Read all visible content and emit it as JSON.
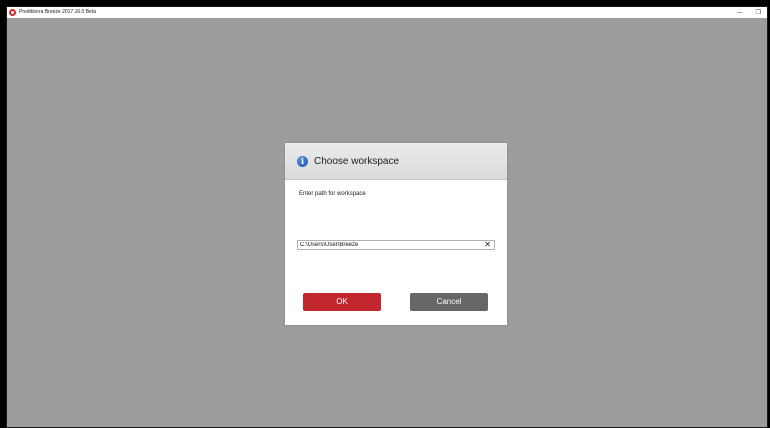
{
  "window": {
    "title": "Predikterra Breeze 2017.16.0 Beta",
    "minimize_glyph": "—",
    "maximize_glyph": "❐"
  },
  "dialog": {
    "title": "Choose workspace",
    "icon": "info-icon",
    "prompt": "Enter path for workspace",
    "path_value": "C:\\Users\\User\\Breeze",
    "clear_glyph": "✕",
    "ok_label": "OK",
    "cancel_label": "Cancel"
  },
  "colors": {
    "background": "#9c9c9c",
    "ok_button": "#c1272d",
    "cancel_button": "#666666"
  }
}
